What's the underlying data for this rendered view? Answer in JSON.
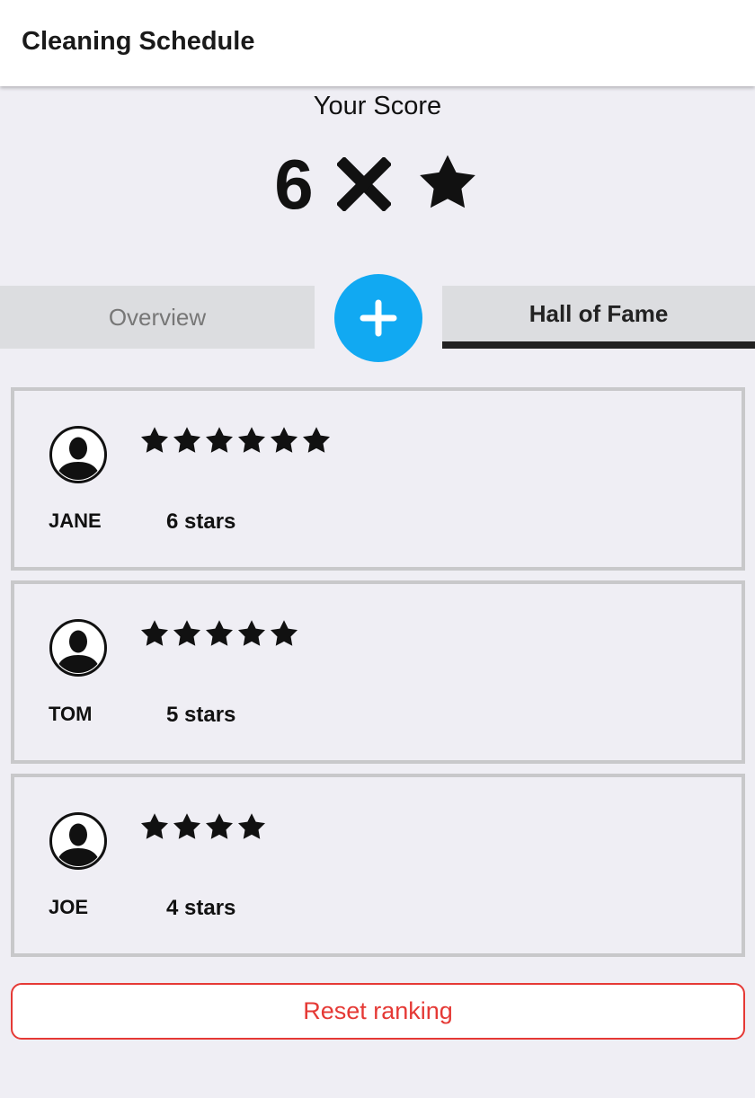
{
  "appbar": {
    "title": "Cleaning Schedule"
  },
  "score": {
    "label": "Your Score",
    "value": "6",
    "times_icon": "times-icon",
    "star_icon": "star-icon"
  },
  "tabs": [
    {
      "label": "Overview",
      "active": false
    },
    {
      "label": "Hall of Fame",
      "active": true
    }
  ],
  "fab": {
    "icon": "plus-icon",
    "color": "#11a9f2"
  },
  "ranking": [
    {
      "name": "JANE",
      "stars": 6,
      "count_label": "6 stars",
      "icon": "user-avatar-icon"
    },
    {
      "name": "TOM",
      "stars": 5,
      "count_label": "5 stars",
      "icon": "user-avatar-icon"
    },
    {
      "name": "JOE",
      "stars": 4,
      "count_label": "4 stars",
      "icon": "user-avatar-icon"
    }
  ],
  "reset_button": {
    "label": "Reset ranking",
    "color": "#e53935"
  }
}
